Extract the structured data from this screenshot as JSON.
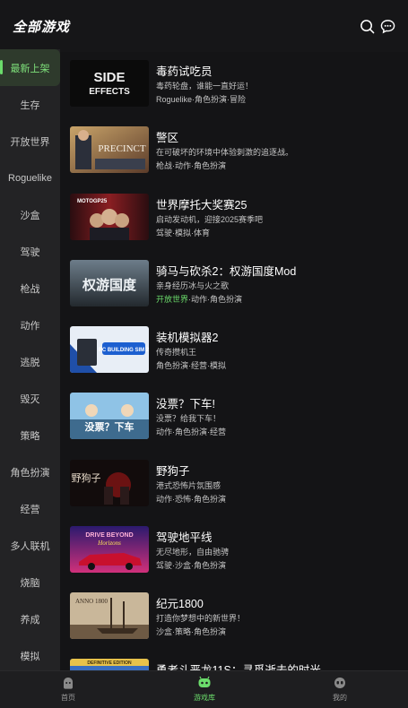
{
  "header": {
    "title": "全部游戏"
  },
  "sidebar": {
    "items": [
      {
        "label": "最新上架",
        "active": true
      },
      {
        "label": "生存"
      },
      {
        "label": "开放世界"
      },
      {
        "label": "Roguelike"
      },
      {
        "label": "沙盒"
      },
      {
        "label": "驾驶"
      },
      {
        "label": "枪战"
      },
      {
        "label": "动作"
      },
      {
        "label": "逃脱"
      },
      {
        "label": "毁灭"
      },
      {
        "label": "策略"
      },
      {
        "label": "角色扮演"
      },
      {
        "label": "经营"
      },
      {
        "label": "多人联机"
      },
      {
        "label": "烧脑"
      },
      {
        "label": "养成"
      },
      {
        "label": "模拟"
      }
    ]
  },
  "games": [
    {
      "title": "毒药试吃员",
      "desc": "毒药轮盘，谁能一直好运！",
      "tags": "Roguelike·角色扮演·冒险",
      "thumb_text": "SIDE EFFECTS"
    },
    {
      "title": "警区",
      "desc": "在可破坏的环境中体验刺激的追逐战。",
      "tags": "枪战·动作·角色扮演",
      "thumb_text": "THE PRECINCT"
    },
    {
      "title": "世界摩托大奖赛25",
      "desc": "启动发动机，迎接2025赛季吧",
      "tags": "驾驶·模拟·体育",
      "thumb_text": "MOTOGP25"
    },
    {
      "title": "骑马与砍杀2：权游国度Mod",
      "desc": "亲身经历冰与火之歌",
      "tags_hl": "开放世界",
      "tags": "·动作·角色扮演",
      "thumb_text": "权游国度"
    },
    {
      "title": "装机模拟器2",
      "desc": "传奇攒机王",
      "tags": "角色扮演·经营·模拟",
      "thumb_text": "PC BUILDING SIMULATOR 2"
    },
    {
      "title": "没票？下车!",
      "desc": "没票？给我下车！",
      "tags": "动作·角色扮演·经营",
      "thumb_text": "没票？下车"
    },
    {
      "title": "野狗子",
      "desc": "港式恐怖片氛围感",
      "tags": "动作·恐怖·角色扮演",
      "thumb_text": "野狗子"
    },
    {
      "title": "驾驶地平线",
      "desc": "无尽地形，自由驰骋",
      "tags": "驾驶·沙盒·角色扮演",
      "thumb_text": "DRIVE BEYOND Horizons"
    },
    {
      "title": "纪元1800",
      "desc": "打造你梦想中的新世界！",
      "tags": "沙盒·策略·角色扮演",
      "thumb_text": "ANNO 1800"
    },
    {
      "title": "勇者斗恶龙11S：寻觅逝去的时光",
      "desc": "",
      "tags": "",
      "thumb_text": "DEFINITIVE EDITION"
    }
  ],
  "tabbar": {
    "items": [
      {
        "label": "首页",
        "icon": "home-icon"
      },
      {
        "label": "游戏库",
        "icon": "game-library-icon",
        "active": true
      },
      {
        "label": "我的",
        "icon": "profile-icon"
      }
    ]
  },
  "colors": {
    "accent": "#6bdc6b",
    "background": "#141416",
    "sidebar": "#232325"
  }
}
